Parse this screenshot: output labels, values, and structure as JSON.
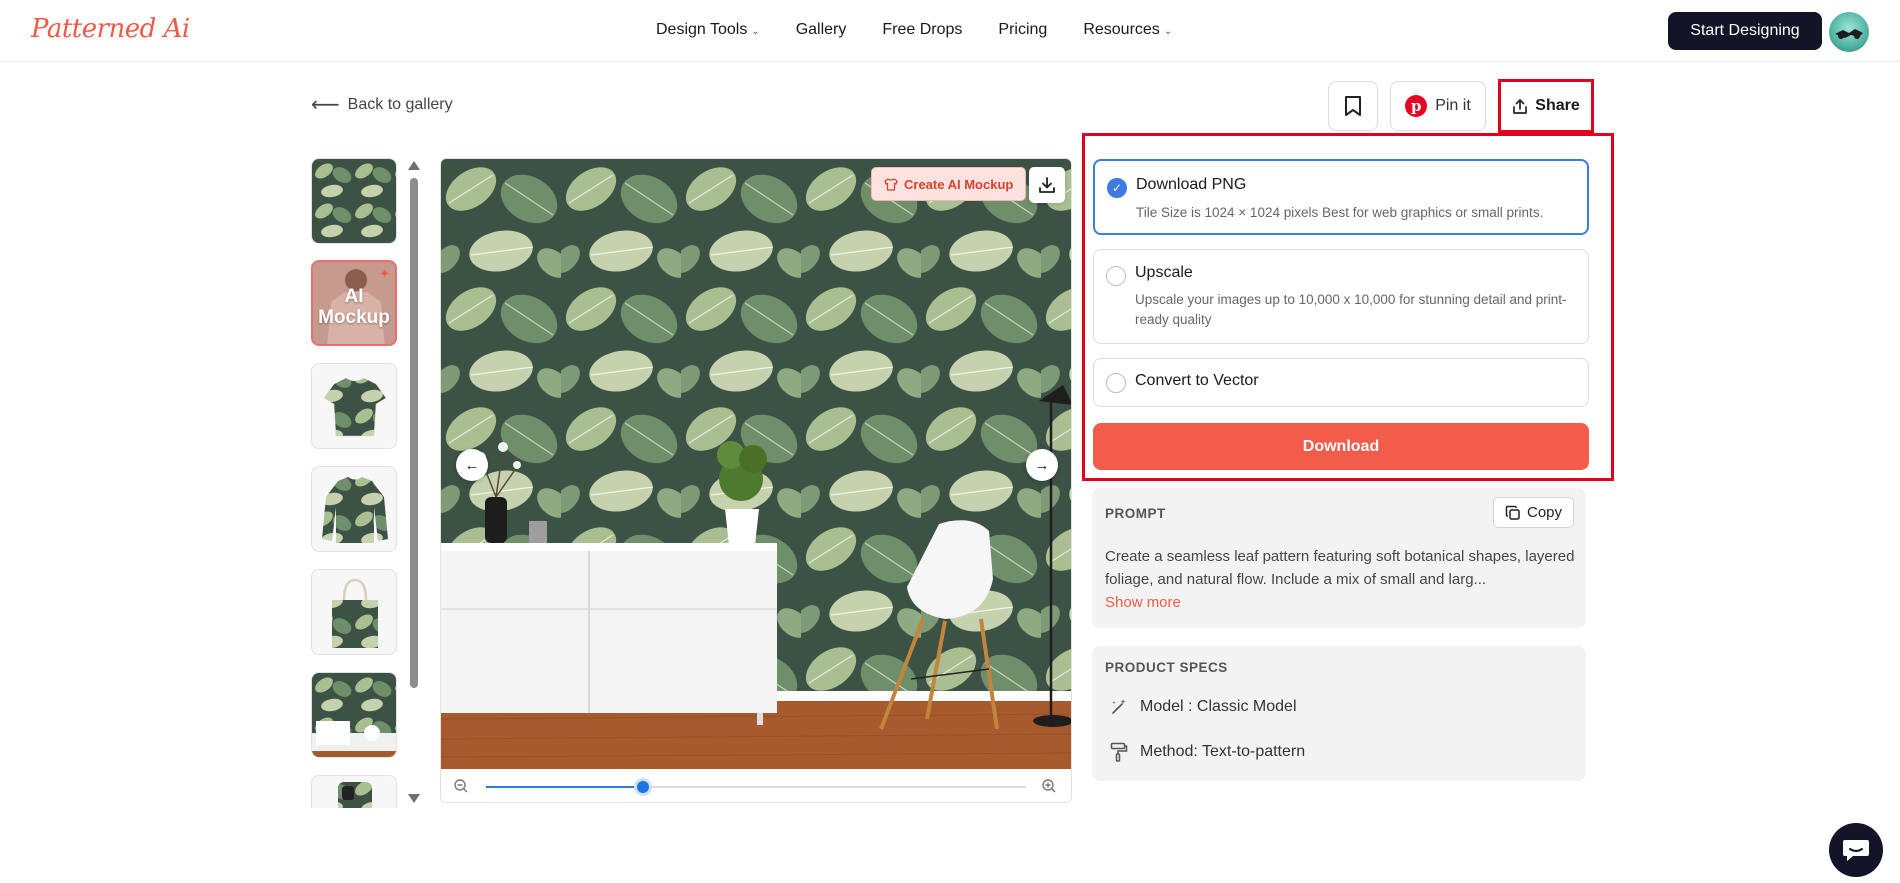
{
  "header": {
    "logo": "Patterned Ai",
    "nav": [
      {
        "label": "Design Tools",
        "has_dropdown": true
      },
      {
        "label": "Gallery",
        "has_dropdown": false
      },
      {
        "label": "Free Drops",
        "has_dropdown": false
      },
      {
        "label": "Pricing",
        "has_dropdown": false
      },
      {
        "label": "Resources",
        "has_dropdown": true
      }
    ],
    "start_button": "Start Designing"
  },
  "back_link": "Back to gallery",
  "actions": {
    "bookmark_icon": "bookmark-icon",
    "pin_label": "Pin it",
    "share_label": "Share"
  },
  "thumbnails": {
    "mockup_label": "AI Mockup",
    "items": [
      "pattern",
      "ai-mockup",
      "t-shirt",
      "sweatshirt",
      "tote-bag",
      "wallpaper-room",
      "phone-case"
    ]
  },
  "viewer": {
    "create_mockup_label": "Create AI Mockup",
    "zoom_level": 0.29
  },
  "download_panel": {
    "options": [
      {
        "title": "Download PNG",
        "desc": "Tile Size is 1024 × 1024 pixels Best for web graphics or small prints.",
        "selected": true
      },
      {
        "title": "Upscale",
        "desc": "Upscale your images up to 10,000 x 10,000 for stunning detail and print-ready quality",
        "selected": false
      },
      {
        "title": "Convert to Vector",
        "desc": "",
        "selected": false
      }
    ],
    "download_label": "Download"
  },
  "prompt": {
    "label": "PROMPT",
    "copy_label": "Copy",
    "text": "Create a seamless leaf pattern featuring soft botanical shapes, layered foliage, and natural flow. Include a mix of small and larg...",
    "show_more": "Show more"
  },
  "specs": {
    "label": "PRODUCT SPECS",
    "model": "Model : Classic Model",
    "method": "Method: Text-to-pattern"
  },
  "colors": {
    "brand": "#ef5b45",
    "accent_blue": "#3d7be0",
    "highlight": "#e0001b"
  }
}
